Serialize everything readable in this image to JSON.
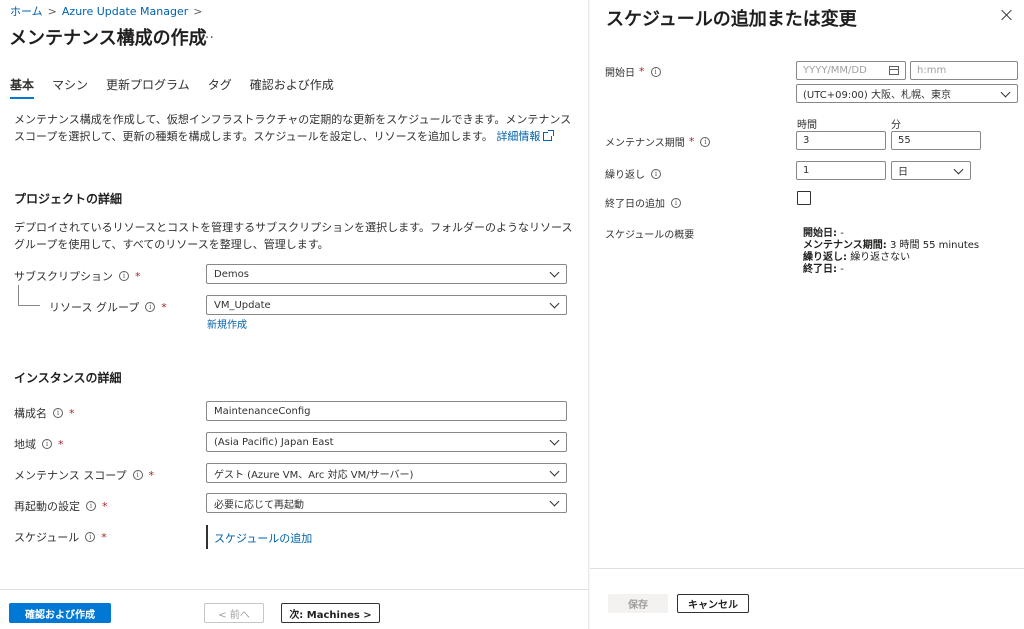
{
  "breadcrumb": {
    "home": "ホーム",
    "sep": ">",
    "service": "Azure Update Manager"
  },
  "page": {
    "title": "メンテナンス構成の作成",
    "more": "…"
  },
  "tabs": [
    {
      "label": "基本"
    },
    {
      "label": "マシン"
    },
    {
      "label": "更新プログラム"
    },
    {
      "label": "タグ"
    },
    {
      "label": "確認および作成"
    }
  ],
  "intro": {
    "text": "メンテナンス構成を作成して、仮想インフラストラクチャの定期的な更新をスケジュールできます。メンテナンス スコープを選択して、更新の種類を構成します。スケジュールを設定し、リソースを追加します。",
    "link": "詳細情報"
  },
  "project": {
    "heading": "プロジェクトの詳細",
    "desc": "デプロイされているリソースとコストを管理するサブスクリプションを選択します。フォルダーのようなリソース グループを使用して、すべてのリソースを整理し、管理します。",
    "subscription_label": "サブスクリプション",
    "subscription_value": "Demos",
    "rg_label": "リソース グループ",
    "rg_value": "VM_Update",
    "new_link": "新規作成"
  },
  "instance": {
    "heading": "インスタンスの詳細",
    "name_label": "構成名",
    "name_value": "MaintenanceConfig",
    "region_label": "地域",
    "region_value": "(Asia Pacific) Japan East",
    "scope_label": "メンテナンス スコープ",
    "scope_value": "ゲスト (Azure VM、Arc 対応 VM/サーバー)",
    "reboot_label": "再起動の設定",
    "reboot_value": "必要に応じて再起動",
    "schedule_label": "スケジュール",
    "schedule_link": "スケジュールの追加"
  },
  "footer": {
    "review": "確認および作成",
    "prev": "< 前へ",
    "next": "次: Machines >"
  },
  "panel": {
    "title": "スケジュールの追加または変更",
    "start_label": "開始日",
    "date_placeholder": "YYYY/MM/DD",
    "time_placeholder": "h:mm",
    "timezone": "(UTC+09:00) 大阪、札幌、東京",
    "hours_head": "時間",
    "minutes_head": "分",
    "duration_label": "メンテナンス期間",
    "hours_value": "3",
    "minutes_value": "55",
    "repeat_label": "繰り返し",
    "repeat_value": "1",
    "repeat_unit": "日",
    "end_label": "終了日の追加",
    "summary_label": "スケジュールの概要",
    "summary": {
      "start_k": "開始日:",
      "start_v": "-",
      "dur_k": "メンテナンス期間:",
      "dur_v": "3 時間 55 minutes",
      "rep_k": "繰り返し:",
      "rep_v": "繰り返さない",
      "end_k": "終了日:",
      "end_v": "-"
    },
    "save": "保存",
    "cancel": "キャンセル"
  },
  "required_mark": "*",
  "info_mark": "i",
  "colors": {
    "accent": "#0078d4",
    "link": "#0062ad",
    "required": "#a4262c"
  }
}
